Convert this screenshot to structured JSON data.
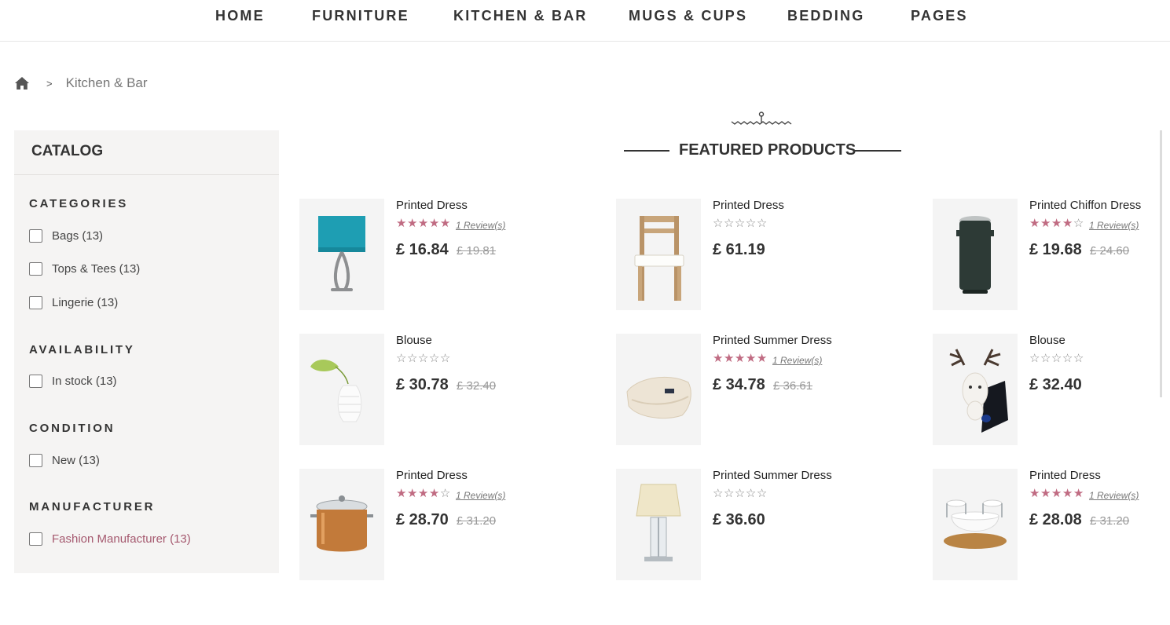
{
  "nav": {
    "items": [
      "HOME",
      "FURNITURE",
      "KITCHEN & BAR",
      "MUGS & CUPS",
      "BEDDING",
      "PAGES"
    ]
  },
  "breadcrumb": {
    "separator": ">",
    "current": "Kitchen & Bar"
  },
  "sidebar": {
    "title": "CATALOG",
    "facets": [
      {
        "title": "CATEGORIES",
        "options": [
          "Bags (13)",
          "Tops & Tees (13)",
          "Lingerie (13)"
        ]
      },
      {
        "title": "AVAILABILITY",
        "options": [
          "In stock (13)"
        ]
      },
      {
        "title": "CONDITION",
        "options": [
          "New (13)"
        ]
      },
      {
        "title": "MANUFACTURER",
        "options": [
          "Fashion Manufacturer (13)"
        ]
      }
    ]
  },
  "featured": {
    "title": "FEATURED PRODUCTS"
  },
  "products": [
    {
      "name": "Printed Dress",
      "rating": 5,
      "review": "1 Review(s)",
      "price": "£ 16.84",
      "old_price": "£ 19.81",
      "image": "lamp-teal"
    },
    {
      "name": "Printed Dress",
      "rating": 0,
      "review": "",
      "price": "£ 61.19",
      "old_price": "",
      "image": "chair"
    },
    {
      "name": "Printed Chiffon Dress",
      "rating": 4,
      "review": "1 Review(s)",
      "price": "£ 19.68",
      "old_price": "£ 24.60",
      "image": "trash-bin"
    },
    {
      "name": "Blouse",
      "rating": 0,
      "review": "",
      "price": "£ 30.78",
      "old_price": "£ 32.40",
      "image": "vase-leaf"
    },
    {
      "name": "Printed Summer Dress",
      "rating": 5,
      "review": "1 Review(s)",
      "price": "£ 34.78",
      "old_price": "£ 36.61",
      "image": "blanket"
    },
    {
      "name": "Blouse",
      "rating": 0,
      "review": "",
      "price": "£ 32.40",
      "old_price": "",
      "image": "deer-head"
    },
    {
      "name": "Printed Dress",
      "rating": 4,
      "review": "1 Review(s)",
      "price": "£ 28.70",
      "old_price": "£ 31.20",
      "image": "copper-pot"
    },
    {
      "name": "Printed Summer Dress",
      "rating": 0,
      "review": "",
      "price": "£ 36.60",
      "old_price": "",
      "image": "lamp-table"
    },
    {
      "name": "Printed Dress",
      "rating": 5,
      "review": "1 Review(s)",
      "price": "£ 28.08",
      "old_price": "£ 31.20",
      "image": "bowl-set"
    }
  ],
  "colors": {
    "accent": "#c06b82",
    "manufacturer_link": "#a5596f",
    "sidebar_bg": "#f5f4f3",
    "thumb_bg": "#f4f4f4"
  },
  "icons": {
    "home": "home-icon",
    "heading_ornament": "ornament-icon",
    "star_full": "star-full-icon",
    "star_empty": "star-empty-icon"
  }
}
